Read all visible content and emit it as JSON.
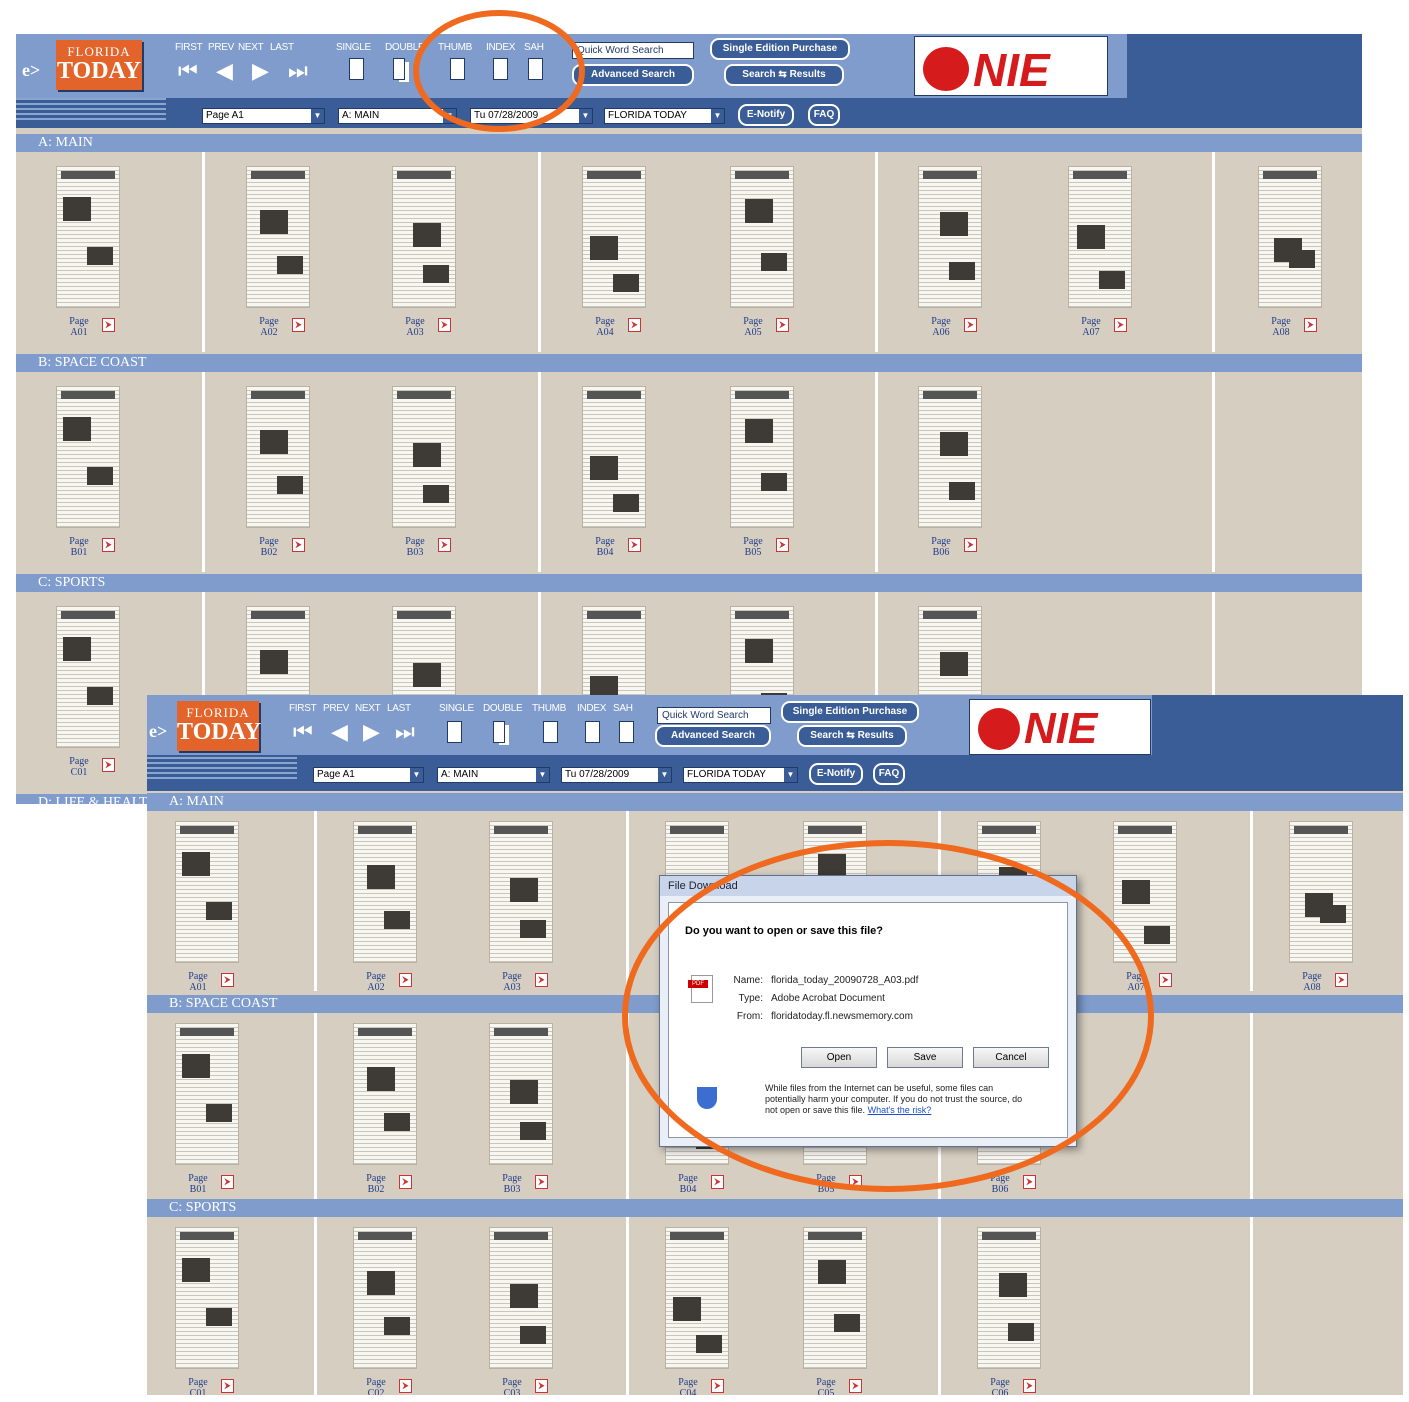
{
  "toolbar": {
    "brand_prefix": "e>",
    "logo_line1": "FLORIDA",
    "logo_line2": "TODAY",
    "nav": [
      "FIRST",
      "PREV",
      "NEXT",
      "LAST"
    ],
    "nav_icons": [
      "first-page-icon",
      "prev-page-icon",
      "next-page-icon",
      "last-page-icon"
    ],
    "view": [
      "SINGLE",
      "DOUBLE",
      "THUMB",
      "INDEX",
      "SAH"
    ],
    "quick_word_search": "Quick Word Search",
    "advanced_search": "Advanced Search",
    "single_edition_purchase": "Single Edition Purchase",
    "search_results": "Search ⇆ Results",
    "page_select": "Page A1",
    "section_select": "A: MAIN",
    "date_select": "Tu 07/28/2009",
    "edition_select": "FLORIDA TODAY",
    "enotify": "E-Notify",
    "faq": "FAQ",
    "nie_text": "NIE"
  },
  "sections": [
    {
      "title": "A: MAIN",
      "pages": [
        "A01",
        "A02",
        "A03",
        "A04",
        "A05",
        "A06",
        "A07",
        "A08"
      ]
    },
    {
      "title": "B: SPACE COAST",
      "pages": [
        "B01",
        "B02",
        "B03",
        "B04",
        "B05",
        "B06"
      ]
    },
    {
      "title": "C: SPORTS",
      "pages": [
        "C01",
        "C02",
        "C03",
        "C04",
        "C05",
        "C06"
      ]
    },
    {
      "title": "D: LIFE & HEALTH",
      "pages": []
    }
  ],
  "page_label": "Page",
  "pdf_icon_label": "⮞",
  "dialog": {
    "title": "File Download",
    "question": "Do you want to open or save this file?",
    "name_key": "Name:",
    "name_val": "florida_today_20090728_A03.pdf",
    "type_key": "Type:",
    "type_val": "Adobe Acrobat Document",
    "from_key": "From:",
    "from_val": "floridatoday.fl.newsmemory.com",
    "open": "Open",
    "save": "Save",
    "cancel": "Cancel",
    "warning": "While files from the Internet can be useful, some files can potentially harm your computer. If you do not trust the source, do not open or save this file.",
    "risk_link": "What's the risk?"
  },
  "colors": {
    "toolbar": "#3a5d97",
    "toolbar_light": "#7f9ccc",
    "content_bg": "#d6cfc1",
    "highlight_ring": "#ef6a1e",
    "nie_red": "#d51b1b"
  }
}
